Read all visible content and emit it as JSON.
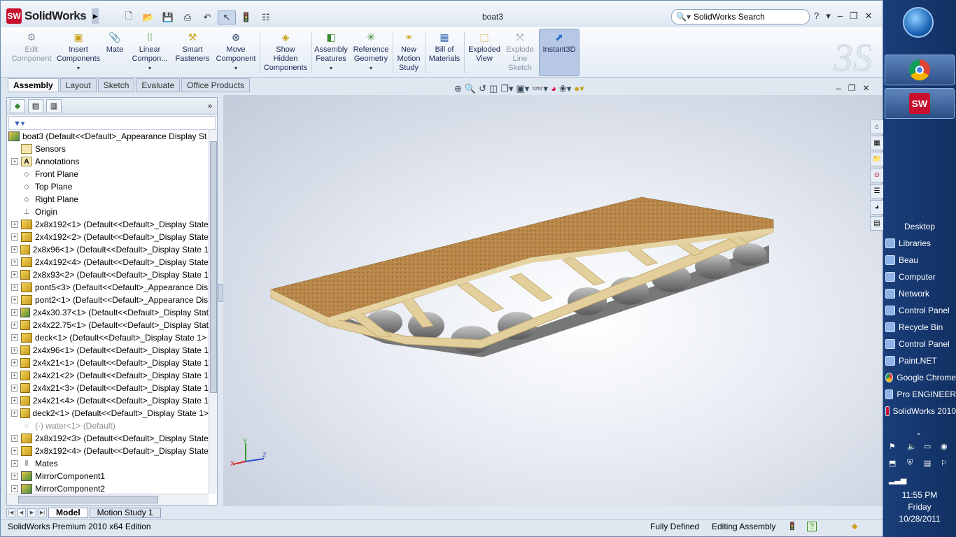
{
  "app": {
    "name": "SolidWorks",
    "document_title": "boat3",
    "search_placeholder": "SolidWorks Search",
    "window_controls": [
      "?",
      "▾",
      "–",
      "❐",
      "✕"
    ]
  },
  "commands": [
    {
      "label": "Edit\nComponent",
      "enabled": false,
      "icon": "edit-component-icon"
    },
    {
      "label": "Insert\nComponents",
      "enabled": true,
      "icon": "insert-components-icon",
      "dropdown": true
    },
    {
      "label": "Mate",
      "enabled": true,
      "icon": "mate-icon"
    },
    {
      "label": "Linear\nCompon...",
      "enabled": true,
      "icon": "linear-pattern-icon",
      "dropdown": true
    },
    {
      "label": "Smart\nFasteners",
      "enabled": true,
      "icon": "smart-fasteners-icon"
    },
    {
      "label": "Move\nComponent",
      "enabled": true,
      "icon": "move-component-icon",
      "dropdown": true
    },
    {
      "label": "Show\nHidden\nComponents",
      "enabled": true,
      "icon": "show-hidden-icon"
    },
    {
      "label": "Assembly\nFeatures",
      "enabled": true,
      "icon": "assembly-features-icon",
      "dropdown": true
    },
    {
      "label": "Reference\nGeometry",
      "enabled": true,
      "icon": "reference-geometry-icon",
      "dropdown": true
    },
    {
      "label": "New\nMotion\nStudy",
      "enabled": true,
      "icon": "motion-study-icon"
    },
    {
      "label": "Bill of\nMaterials",
      "enabled": true,
      "icon": "bom-icon"
    },
    {
      "label": "Exploded\nView",
      "enabled": true,
      "icon": "exploded-view-icon"
    },
    {
      "label": "Explode\nLine\nSketch",
      "enabled": false,
      "icon": "explode-line-icon"
    },
    {
      "label": "Instant3D",
      "enabled": true,
      "icon": "instant3d-icon",
      "active": true
    }
  ],
  "tabs": [
    "Assembly",
    "Layout",
    "Sketch",
    "Evaluate",
    "Office Products"
  ],
  "active_tab": "Assembly",
  "tree": {
    "root": "boat3  (Default<<Default>_Appearance Display St",
    "nodes": [
      {
        "label": "Sensors",
        "icon": "folder",
        "expand": false
      },
      {
        "label": "Annotations",
        "icon": "annotation",
        "expand": true
      },
      {
        "label": "Front Plane",
        "icon": "plane",
        "expand": false
      },
      {
        "label": "Top Plane",
        "icon": "plane",
        "expand": false
      },
      {
        "label": "Right Plane",
        "icon": "plane",
        "expand": false
      },
      {
        "label": "Origin",
        "icon": "origin",
        "expand": false
      },
      {
        "label": "2x8x192<1> (Default<<Default>_Display State",
        "icon": "part",
        "expand": true
      },
      {
        "label": "2x4x192<2> (Default<<Default>_Display State",
        "icon": "part",
        "expand": true
      },
      {
        "label": "2x8x96<1> (Default<<Default>_Display State 1",
        "icon": "part",
        "expand": true
      },
      {
        "label": "2x4x192<4> (Default<<Default>_Display State",
        "icon": "part",
        "expand": true
      },
      {
        "label": "2x8x93<2> (Default<<Default>_Display State 1",
        "icon": "part",
        "expand": true
      },
      {
        "label": "pont5<3> (Default<<Default>_Appearance Dis",
        "icon": "part",
        "expand": true
      },
      {
        "label": "pont2<1> (Default<<Default>_Appearance Dis",
        "icon": "part",
        "expand": true
      },
      {
        "label": "2x4x30.37<1> (Default<<Default>_Display Stat",
        "icon": "asm",
        "expand": true
      },
      {
        "label": "2x4x22.75<1> (Default<<Default>_Display Stat",
        "icon": "part",
        "expand": true
      },
      {
        "label": "deck<1> (Default<<Default>_Display State 1>",
        "icon": "part",
        "expand": true
      },
      {
        "label": "2x4x96<1> (Default<<Default>_Display State 1",
        "icon": "part",
        "expand": true
      },
      {
        "label": "2x4x21<1> (Default<<Default>_Display State 1",
        "icon": "part",
        "expand": true
      },
      {
        "label": "2x4x21<2> (Default<<Default>_Display State 1",
        "icon": "part",
        "expand": true
      },
      {
        "label": "2x4x21<3> (Default<<Default>_Display State 1",
        "icon": "part",
        "expand": true
      },
      {
        "label": "2x4x21<4> (Default<<Default>_Display State 1",
        "icon": "part",
        "expand": true
      },
      {
        "label": "deck2<1> (Default<<Default>_Display State 1>",
        "icon": "part",
        "expand": true
      },
      {
        "label": "(-) water<1> (Default)",
        "icon": "part-grey",
        "expand": false,
        "grey": true
      },
      {
        "label": "2x8x192<3> (Default<<Default>_Display State",
        "icon": "part",
        "expand": true
      },
      {
        "label": "2x8x192<4> (Default<<Default>_Display State",
        "icon": "part",
        "expand": true
      },
      {
        "label": "Mates",
        "icon": "mates",
        "expand": true
      },
      {
        "label": "MirrorComponent1",
        "icon": "mirror",
        "expand": true
      },
      {
        "label": "MirrorComponent2",
        "icon": "mirror",
        "expand": true
      }
    ]
  },
  "bottom_tabs": [
    "Model",
    "Motion Study 1"
  ],
  "active_bottom_tab": "Model",
  "status": {
    "edition": "SolidWorks Premium 2010 x64 Edition",
    "state": "Fully Defined",
    "mode": "Editing Assembly"
  },
  "axis_labels": {
    "x": "X",
    "y": "Y",
    "z": "Z"
  },
  "desktop": {
    "header": "Desktop",
    "items": [
      "Libraries",
      "Beau",
      "Computer",
      "Network",
      "Control Panel",
      "Recycle Bin",
      "Control Panel",
      "Paint.NET",
      "Google Chrome",
      "Pro ENGINEER",
      "SolidWorks 2010"
    ]
  },
  "clock": {
    "time": "11:55 PM",
    "day": "Friday",
    "date": "10/28/2011"
  },
  "colors": {
    "accent": "#c8102e",
    "deck": "#b9874a",
    "frame": "#e2cf9c",
    "pontoon": "#7c7c7c"
  }
}
